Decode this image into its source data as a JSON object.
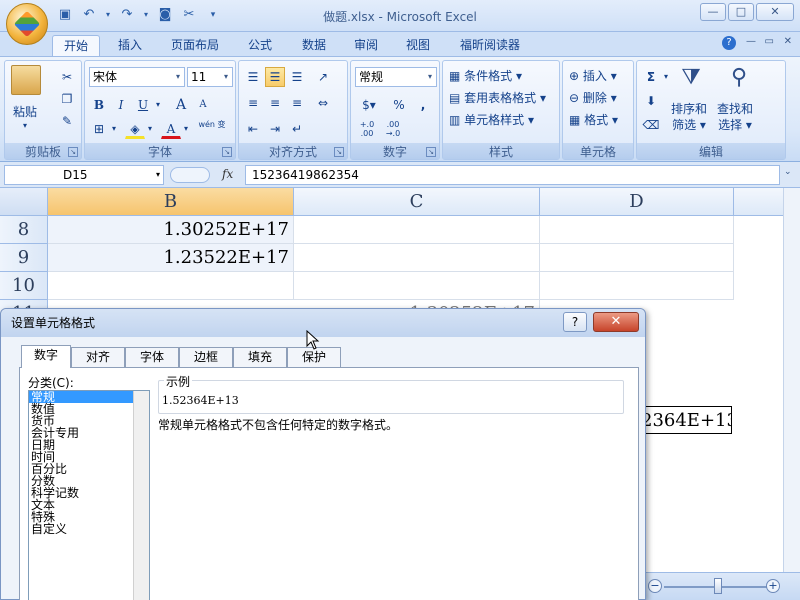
{
  "window": {
    "title": "做题.xlsx - Microsoft Excel",
    "btn_min": "—",
    "btn_max": "□",
    "btn_close": "✕"
  },
  "quick_access": [
    "save-icon",
    "undo-icon",
    "redo-icon",
    "camera-icon",
    "tools-icon",
    "customize-icon"
  ],
  "tabs": [
    {
      "label": "开始",
      "active": true
    },
    {
      "label": "插入"
    },
    {
      "label": "页面布局"
    },
    {
      "label": "公式"
    },
    {
      "label": "数据"
    },
    {
      "label": "审阅"
    },
    {
      "label": "视图"
    },
    {
      "label": "福昕阅读器"
    }
  ],
  "ribbon": {
    "clipboard": {
      "group": "剪贴板",
      "paste": "粘贴"
    },
    "font": {
      "group": "字体",
      "name": "宋体",
      "size": "11",
      "bold": "B",
      "italic": "I",
      "underline": "U",
      "grow": "A",
      "shrink": "A",
      "font_color": "A",
      "wen": "wén 变"
    },
    "align": {
      "group": "对齐方式"
    },
    "number": {
      "group": "数字",
      "format": "常规",
      "percent": "%",
      "comma": ",",
      "inc": "+.0 .00",
      "dec": ".00 →.0"
    },
    "styles": {
      "group": "样式",
      "conditional": "条件格式",
      "table": "套用表格格式",
      "cell": "单元格样式"
    },
    "cells": {
      "group": "单元格",
      "insert": "插入",
      "delete": "删除",
      "format": "格式"
    },
    "editing": {
      "group": "编辑",
      "sigma": "Σ",
      "sort_filter_1": "排序和",
      "sort_filter_2": "筛选",
      "find_select_1": "查找和",
      "find_select_2": "选择"
    }
  },
  "formula_bar": {
    "name_box": "D15",
    "fx": "fx",
    "content": "15236419862354"
  },
  "sheet": {
    "columns": [
      {
        "label": "B",
        "selected": true
      },
      {
        "label": "C"
      },
      {
        "label": "D"
      }
    ],
    "rows": [
      {
        "num": "8",
        "b": "1.30252E+17",
        "c": "",
        "d": ""
      },
      {
        "num": "9",
        "b": "1.23522E+17",
        "c": "",
        "d": ""
      },
      {
        "num": "10",
        "b": "",
        "c": "",
        "d": ""
      },
      {
        "num": "11",
        "b": "",
        "c": "1.30252E+17",
        "d": ""
      }
    ],
    "d15_visible": "2364E+13"
  },
  "dialog": {
    "title": "设置单元格格式",
    "help": "?",
    "close": "✕",
    "tabs": [
      "数字",
      "对齐",
      "字体",
      "边框",
      "填充",
      "保护"
    ],
    "category_label": "分类(C):",
    "categories": [
      "常规",
      "数值",
      "货币",
      "会计专用",
      "日期",
      "时间",
      "百分比",
      "分数",
      "科学记数",
      "文本",
      "特殊",
      "自定义"
    ],
    "selected_category": 0,
    "sample_label": "示例",
    "sample_value": "1.52364E+13",
    "description": "常规单元格格式不包含任何特定的数字格式。"
  },
  "zoom": {
    "minus": "−",
    "plus": "+"
  }
}
